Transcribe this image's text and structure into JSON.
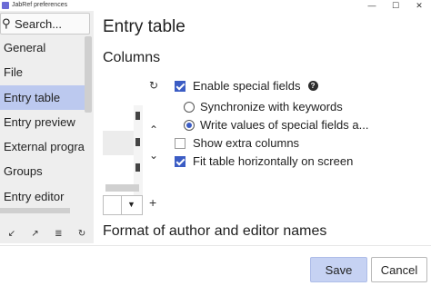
{
  "window": {
    "title": "JabRef preferences",
    "controls": [
      "—",
      "☐",
      "✕"
    ]
  },
  "sidebar": {
    "search_text": "Search...",
    "items": [
      {
        "label": "General"
      },
      {
        "label": "File"
      },
      {
        "label": "Entry table",
        "selected": true
      },
      {
        "label": "Entry preview"
      },
      {
        "label": "External programs"
      },
      {
        "label": "Groups"
      },
      {
        "label": "Entry editor"
      }
    ],
    "tools": {
      "import": "↙",
      "export": "↗",
      "show": "≣",
      "reset": "↻"
    }
  },
  "main": {
    "page_title": "Entry table",
    "columns_title": "Columns",
    "format_title": "Format of author and editor names",
    "controls": {
      "reload": "↻",
      "move_up": "⌃",
      "move_down": "⌄",
      "add": "+"
    },
    "options": {
      "enable_special_fields": {
        "label": "Enable special fields",
        "checked": true
      },
      "sync_keywords": {
        "label": "Synchronize with keywords",
        "checked": false
      },
      "write_values": {
        "label": "Write values of special fields a...",
        "checked": true
      },
      "show_extra_columns": {
        "label": "Show extra columns",
        "checked": false
      },
      "fit_table": {
        "label": "Fit table horizontally on screen",
        "checked": true
      }
    }
  },
  "buttons": {
    "save": "Save",
    "cancel": "Cancel"
  },
  "colors": {
    "selected_nav": "#bcc9ef",
    "accent": "#3b5cc4",
    "save_button": "#c6d2f3"
  }
}
